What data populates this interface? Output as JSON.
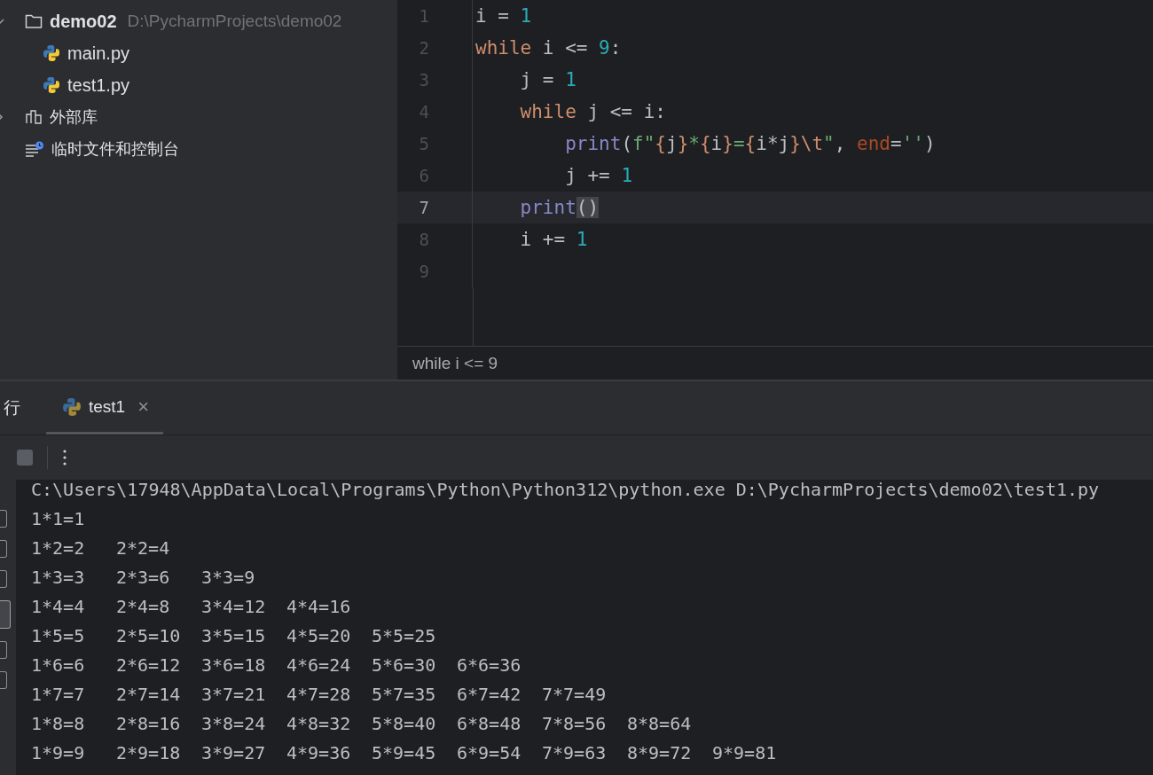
{
  "project_tree": [
    {
      "kind": "folder",
      "name": "demo02",
      "path": "D:\\PycharmProjects\\demo02",
      "expanded": true,
      "children": [
        {
          "kind": "python",
          "name": "main.py"
        },
        {
          "kind": "python",
          "name": "test1.py"
        }
      ]
    },
    {
      "kind": "library",
      "name": "外部库",
      "expanded": false
    },
    {
      "kind": "scratches",
      "name": "临时文件和控制台"
    }
  ],
  "editor": {
    "lines": [
      {
        "number": "1",
        "current": false,
        "tokens": [
          {
            "text": "i = ",
            "kind": "plain"
          },
          {
            "text": "1",
            "kind": "number"
          }
        ]
      },
      {
        "number": "2",
        "current": false,
        "tokens": [
          {
            "text": "while",
            "kind": "keyword"
          },
          {
            "text": " i <= ",
            "kind": "plain"
          },
          {
            "text": "9",
            "kind": "number"
          },
          {
            "text": ":",
            "kind": "plain"
          }
        ]
      },
      {
        "number": "3",
        "current": false,
        "tokens": [
          {
            "text": "    j = ",
            "kind": "plain"
          },
          {
            "text": "1",
            "kind": "number"
          }
        ]
      },
      {
        "number": "4",
        "current": false,
        "tokens": [
          {
            "text": "    while",
            "kind": "keyword"
          },
          {
            "text": " j <= i:",
            "kind": "plain"
          }
        ]
      },
      {
        "number": "5",
        "current": false,
        "tokens": [
          {
            "text": "        print",
            "kind": "builtin"
          },
          {
            "text": "(",
            "kind": "plain"
          },
          {
            "text": "f\"",
            "kind": "string"
          },
          {
            "text": "{",
            "kind": "brace"
          },
          {
            "text": "j",
            "kind": "plain"
          },
          {
            "text": "}",
            "kind": "brace"
          },
          {
            "text": "*",
            "kind": "string"
          },
          {
            "text": "{",
            "kind": "brace"
          },
          {
            "text": "i",
            "kind": "plain"
          },
          {
            "text": "}",
            "kind": "brace"
          },
          {
            "text": "=",
            "kind": "string"
          },
          {
            "text": "{",
            "kind": "brace"
          },
          {
            "text": "i*j",
            "kind": "plain"
          },
          {
            "text": "}\\t",
            "kind": "brace"
          },
          {
            "text": "\"",
            "kind": "string"
          },
          {
            "text": ", ",
            "kind": "plain"
          },
          {
            "text": "end",
            "kind": "named"
          },
          {
            "text": "=",
            "kind": "plain"
          },
          {
            "text": "''",
            "kind": "string"
          },
          {
            "text": ")",
            "kind": "plain"
          }
        ]
      },
      {
        "number": "6",
        "current": false,
        "tokens": [
          {
            "text": "        j += ",
            "kind": "plain"
          },
          {
            "text": "1",
            "kind": "number"
          }
        ]
      },
      {
        "number": "7",
        "current": true,
        "tokens": [
          {
            "text": "    print",
            "kind": "builtin"
          },
          {
            "text": "()",
            "kind": "matched"
          }
        ]
      },
      {
        "number": "8",
        "current": false,
        "tokens": [
          {
            "text": "    i += ",
            "kind": "plain"
          },
          {
            "text": "1",
            "kind": "number"
          }
        ]
      },
      {
        "number": "9",
        "current": false
      }
    ],
    "breadcrumb": "while i <= 9"
  },
  "run_panel": {
    "title": "行",
    "tabs": [
      {
        "label": "test1",
        "selected": true,
        "close": "×"
      }
    ],
    "side_tools": [
      {
        "selected": false
      },
      {
        "selected": false
      },
      {
        "selected": false
      },
      {
        "selected": true
      },
      {
        "selected": false
      },
      {
        "selected": false
      }
    ],
    "console": {
      "command": "C:\\Users\\17948\\AppData\\Local\\Programs\\Python\\Python312\\python.exe D:\\PycharmProjects\\demo02\\test1.py",
      "rows": [
        [
          "1*1=1"
        ],
        [
          "1*2=2",
          "2*2=4"
        ],
        [
          "1*3=3",
          "2*3=6",
          "3*3=9"
        ],
        [
          "1*4=4",
          "2*4=8",
          "3*4=12",
          "4*4=16"
        ],
        [
          "1*5=5",
          "2*5=10",
          "3*5=15",
          "4*5=20",
          "5*5=25"
        ],
        [
          "1*6=6",
          "2*6=12",
          "3*6=18",
          "4*6=24",
          "5*6=30",
          "6*6=36"
        ],
        [
          "1*7=7",
          "2*7=14",
          "3*7=21",
          "4*7=28",
          "5*7=35",
          "6*7=42",
          "7*7=49"
        ],
        [
          "1*8=8",
          "2*8=16",
          "3*8=24",
          "4*8=32",
          "5*8=40",
          "6*8=48",
          "7*8=56",
          "8*8=64"
        ],
        [
          "1*9=9",
          "2*9=18",
          "3*9=27",
          "4*9=36",
          "5*9=45",
          "6*9=54",
          "7*9=63",
          "8*9=72",
          "9*9=81"
        ]
      ]
    }
  }
}
